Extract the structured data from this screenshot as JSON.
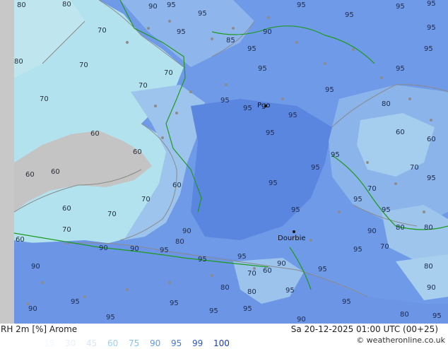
{
  "map": {
    "city": {
      "name": "Dourbie"
    },
    "city2": {
      "name": "Pgo"
    },
    "contour_labels": [
      "80",
      "70",
      "60",
      "90",
      "95"
    ],
    "colors": {
      "sea": "#6f9ae8",
      "sea_deep": "#5a86e0",
      "land_low": "#b2e2ee",
      "land_mid": "#9cc8ec",
      "gray": "#c0c0c0",
      "coast": "#1e9a1e",
      "contour": "#8a8a8a"
    }
  },
  "footer": {
    "title": "RH 2m [%] Arome",
    "time": "Sa 20-12-2025 01:00 UTC (00+25)",
    "credit": "© weatheronline.co.uk",
    "legend": [
      {
        "value": "15",
        "color": "#f0f8ff"
      },
      {
        "value": "30",
        "color": "#e6f0fa"
      },
      {
        "value": "45",
        "color": "#d4e8f5"
      },
      {
        "value": "60",
        "color": "#9ad4f0"
      },
      {
        "value": "75",
        "color": "#7cc4f0"
      },
      {
        "value": "90",
        "color": "#5a9ee6"
      },
      {
        "value": "95",
        "color": "#3f7ad8"
      },
      {
        "value": "99",
        "color": "#2a58c8"
      },
      {
        "value": "100",
        "color": "#1a3cb0"
      }
    ]
  }
}
